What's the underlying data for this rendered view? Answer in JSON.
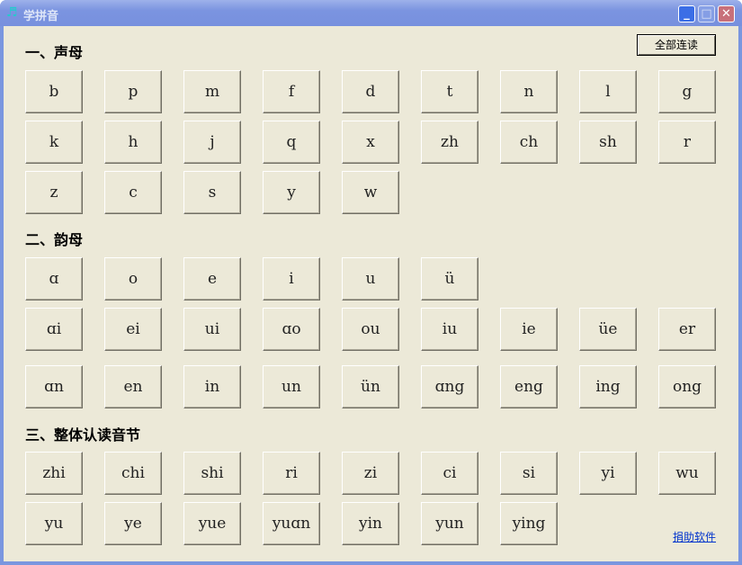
{
  "window": {
    "title": "学拼音",
    "icon": "music-note-icon"
  },
  "read_all_label": "全部连读",
  "donate_label": "捐助软件",
  "sections": [
    {
      "heading": "一、声母",
      "rows": [
        [
          "b",
          "p",
          "m",
          "f",
          "d",
          "t",
          "n",
          "l",
          "g"
        ],
        [
          "k",
          "h",
          "j",
          "q",
          "x",
          "zh",
          "ch",
          "sh",
          "r"
        ],
        [
          "z",
          "c",
          "s",
          "y",
          "w"
        ]
      ]
    },
    {
      "heading": "二、韵母",
      "rows": [
        [
          "ɑ",
          "o",
          "e",
          "i",
          "u",
          "ü"
        ],
        [
          "ɑi",
          "ei",
          "ui",
          "ɑo",
          "ou",
          "iu",
          "ie",
          "üe",
          "er"
        ],
        [
          "ɑn",
          "en",
          "in",
          "un",
          "ün",
          "ɑng",
          "eng",
          "ing",
          "ong"
        ]
      ]
    },
    {
      "heading": "三、整体认读音节",
      "rows": [
        [
          "zhi",
          "chi",
          "shi",
          "ri",
          "zi",
          "ci",
          "si",
          "yi",
          "wu"
        ],
        [
          "yu",
          "ye",
          "yue",
          "yuɑn",
          "yin",
          "yun",
          "ying"
        ]
      ]
    }
  ]
}
